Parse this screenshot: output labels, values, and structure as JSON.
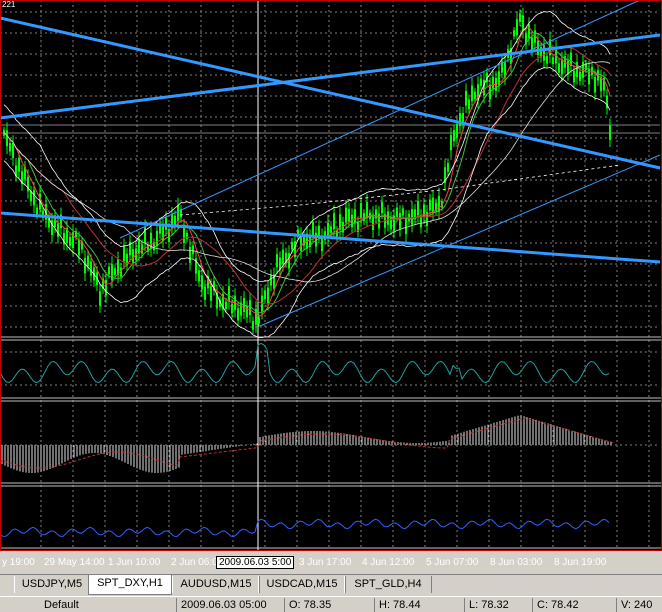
{
  "chart": {
    "corner_label": "221",
    "time_labels": [
      "y 19:00",
      "29 May 14:00",
      "1 Jun 10:00",
      "2 Jun 06:00",
      "3 Jun 17:00",
      "4 Jun 12:00",
      "5 Jun 07:00",
      "8 Jun 03:00",
      "8 Jun 19:00"
    ],
    "time_cursor": "2009.06.03 5:00"
  },
  "tabs": [
    {
      "label": "USDJPY,M5",
      "active": false
    },
    {
      "label": "SPT_DXY,H1",
      "active": true
    },
    {
      "label": "AUDUSD,M15",
      "active": false
    },
    {
      "label": "USDCAD,M15",
      "active": false
    },
    {
      "label": "SPT_GLD,H4",
      "active": false
    }
  ],
  "status": {
    "profile": "Default",
    "datetime": "2009.06.03 05:00",
    "open": "O: 78.35",
    "high": "H: 78.44",
    "low": "L: 78.32",
    "close": "C: 78.42",
    "volume": "V: 240"
  },
  "colors": {
    "background": "#000000",
    "candle": "#00ff00",
    "trendline": "#3399ff",
    "grid": "#808080",
    "ma_red": "#c03030",
    "bollinger": "#ffffff",
    "rsi": "#20a0a0",
    "macd_signal": "#c03030",
    "bottom_indicator": "#3060ff"
  }
}
